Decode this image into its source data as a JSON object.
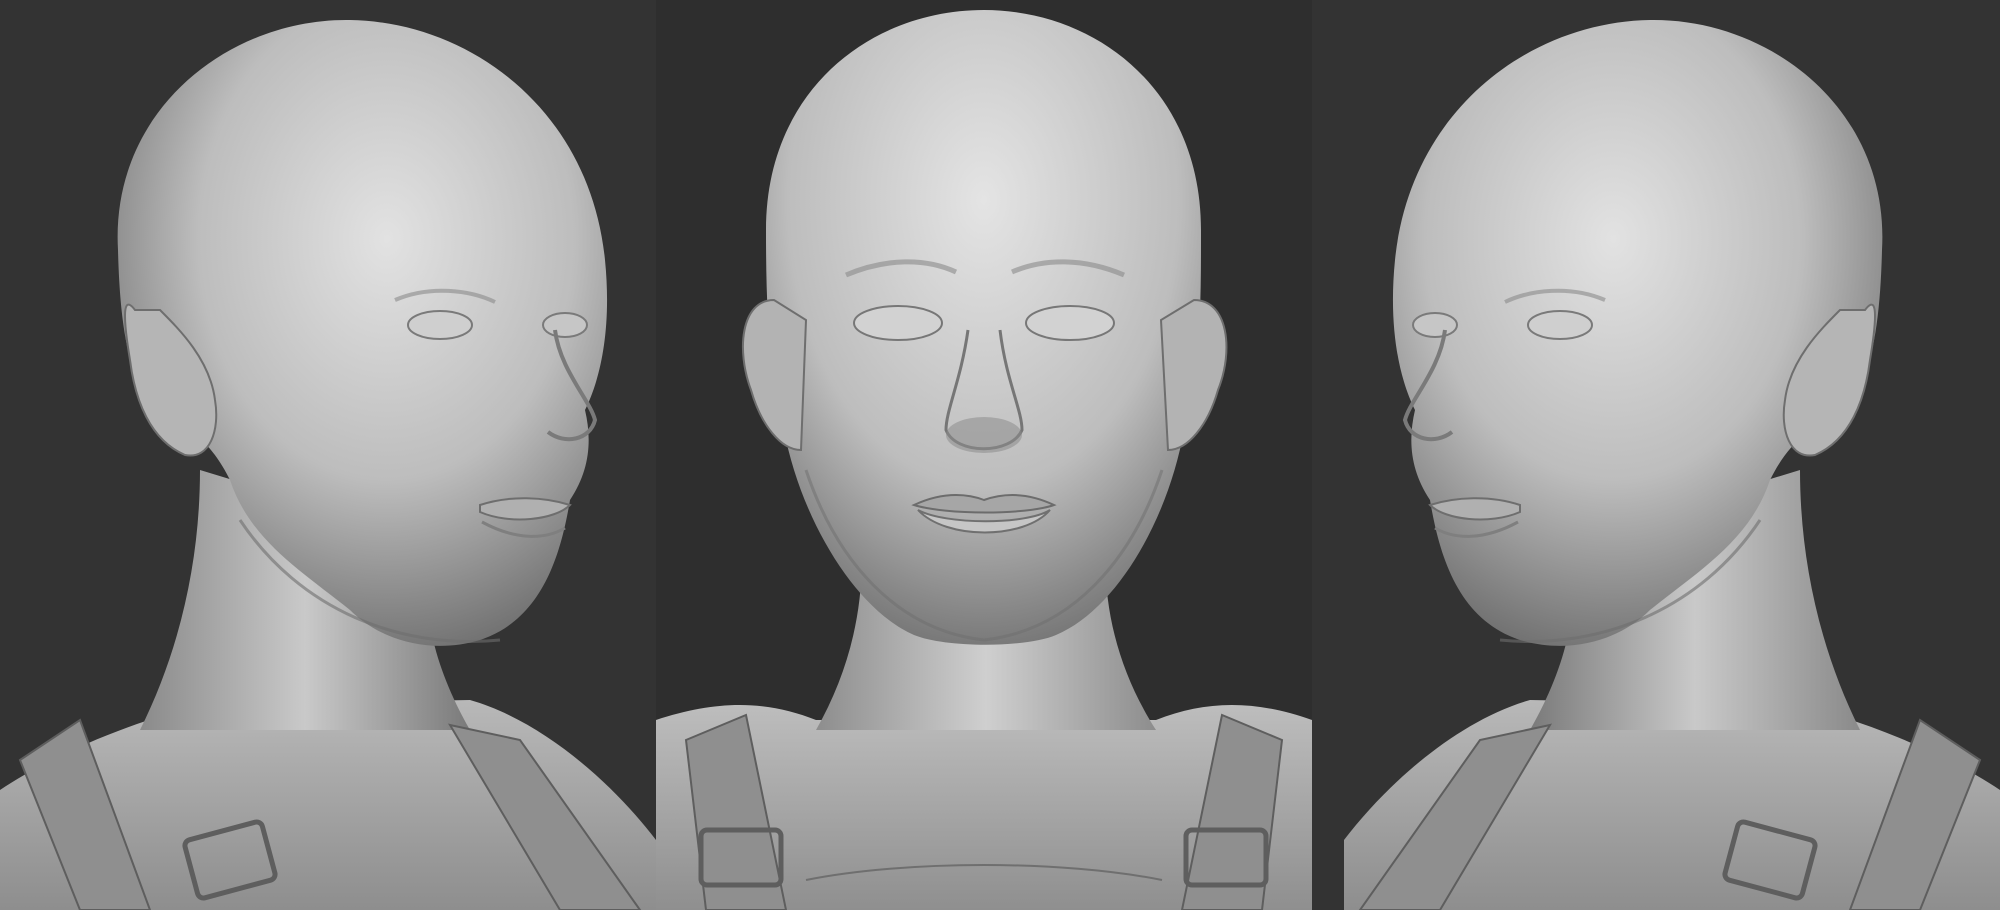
{
  "scene": {
    "views": [
      {
        "view": "three-quarter-right",
        "label": ""
      },
      {
        "view": "front",
        "label": ""
      },
      {
        "view": "three-quarter-left",
        "label": ""
      }
    ],
    "colors": {
      "background": "#333333",
      "background_center": "#2e2e2e",
      "clay_light": "#d6d6d6",
      "clay_mid": "#a9a9a9",
      "clay_dark": "#6e6e6e",
      "strap": "#8f8f8f"
    },
    "icons": [
      "sculpt-head-3q-right",
      "sculpt-head-front",
      "sculpt-head-3q-left"
    ]
  }
}
